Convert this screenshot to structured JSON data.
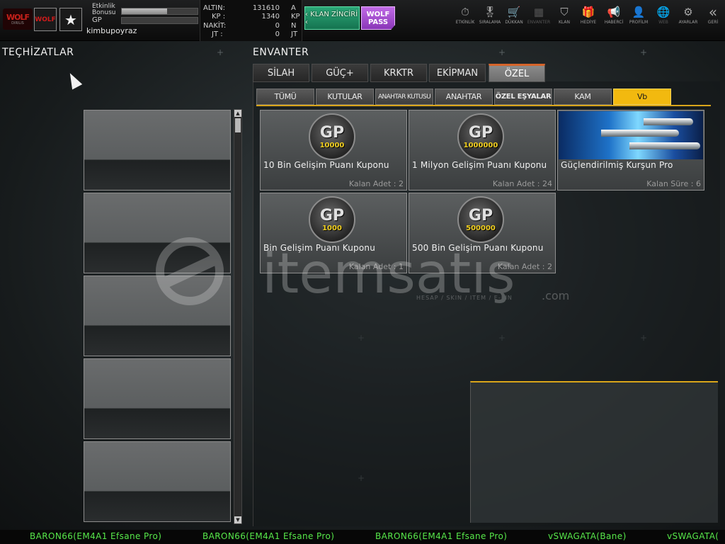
{
  "header": {
    "logo_text": "WOLF",
    "logo_sub": "DIRILIS",
    "rank_badge": "WOLF",
    "star_icon": "★",
    "event_bonus_label": "Etkinlik Bonusu",
    "event_bonus_fill": 0.6,
    "gp_label": "GP",
    "gp_fill": 0,
    "username": "kimbupoyraz"
  },
  "currencies": [
    {
      "label": "ALTIN:",
      "value": "131610",
      "unit": "A"
    },
    {
      "label": "KP :",
      "value": "1340",
      "unit": "KP"
    },
    {
      "label": "NAKİT:",
      "value": "0",
      "unit": "N"
    },
    {
      "label": "JT :",
      "value": "0",
      "unit": "JT"
    }
  ],
  "buttons": {
    "klan_zinciri": "‹ KLAN ZİNCİRİ ‹",
    "wolf_pass": "WOLF PASS"
  },
  "nav": [
    {
      "label": "ETKİNLİK",
      "icon": "⏱"
    },
    {
      "label": "SIRALAMA",
      "icon": "🎖"
    },
    {
      "label": "DÜKKAN",
      "icon": "🛒"
    },
    {
      "label": "ENVANTER",
      "icon": "▦"
    },
    {
      "label": "KLAN",
      "icon": "⛉"
    },
    {
      "label": "HEDİYE",
      "icon": "🎁"
    },
    {
      "label": "HABERCİ",
      "icon": "📢"
    },
    {
      "label": "PROFİLM",
      "icon": "👤"
    },
    {
      "label": "WEB",
      "icon": "🌐"
    },
    {
      "label": "AYARLAR",
      "icon": "⚙"
    },
    {
      "label": "GERİ",
      "icon": "«"
    }
  ],
  "equipment_title": "TEÇHİZATLAR",
  "inventory_title": "ENVANTER",
  "tabs": [
    "SİLAH",
    "GÜÇ+",
    "KRKTR",
    "EKİPMAN",
    "ÖZEL"
  ],
  "subtabs": [
    "TÜMÜ",
    "KUTULAR",
    "ANAHTAR KUTUSU",
    "ANAHTAR",
    "ÖZEL EŞYALAR",
    "KAM",
    "Vb"
  ],
  "items": [
    {
      "name": "10 Bin Gelişim Puanı Kuponu",
      "qty": "Kalan Adet : 2",
      "coin": "10000"
    },
    {
      "name": "1 Milyon Gelişim Puanı Kuponu",
      "qty": "Kalan Adet : 24",
      "coin": "1000000"
    },
    {
      "name": "Güçlendirilmiş Kurşun Pro",
      "qty": "Kalan Süre : 6",
      "coin": ""
    },
    {
      "name": "Bin Gelişim Puanı Kuponu",
      "qty": "Kalan Adet : 1",
      "coin": "1000"
    },
    {
      "name": "500 Bin Gelişim Puanı Kuponu",
      "qty": "Kalan Adet : 2",
      "coin": "500000"
    }
  ],
  "coin_text": "GP",
  "watermark": {
    "brand": "itemsatış",
    "tagline": "HESAP / SKIN / ITEM / E-PIN",
    "suffix": ".com"
  },
  "ticker": [
    "BARON66(EM4A1 Efsane Pro)",
    "BARON66(EM4A1 Efsane Pro)",
    "BARON66(EM4A1 Efsane Pro)",
    "vSWAGATA(Bane)",
    "vSWAGATA("
  ],
  "colors": {
    "accent_yellow": "#f2b90f",
    "tab_active_top": "#d5642a",
    "ticker_green": "#57e84a",
    "klan_green": "#1f8c5f",
    "wolf_purple": "#a24fd0"
  }
}
